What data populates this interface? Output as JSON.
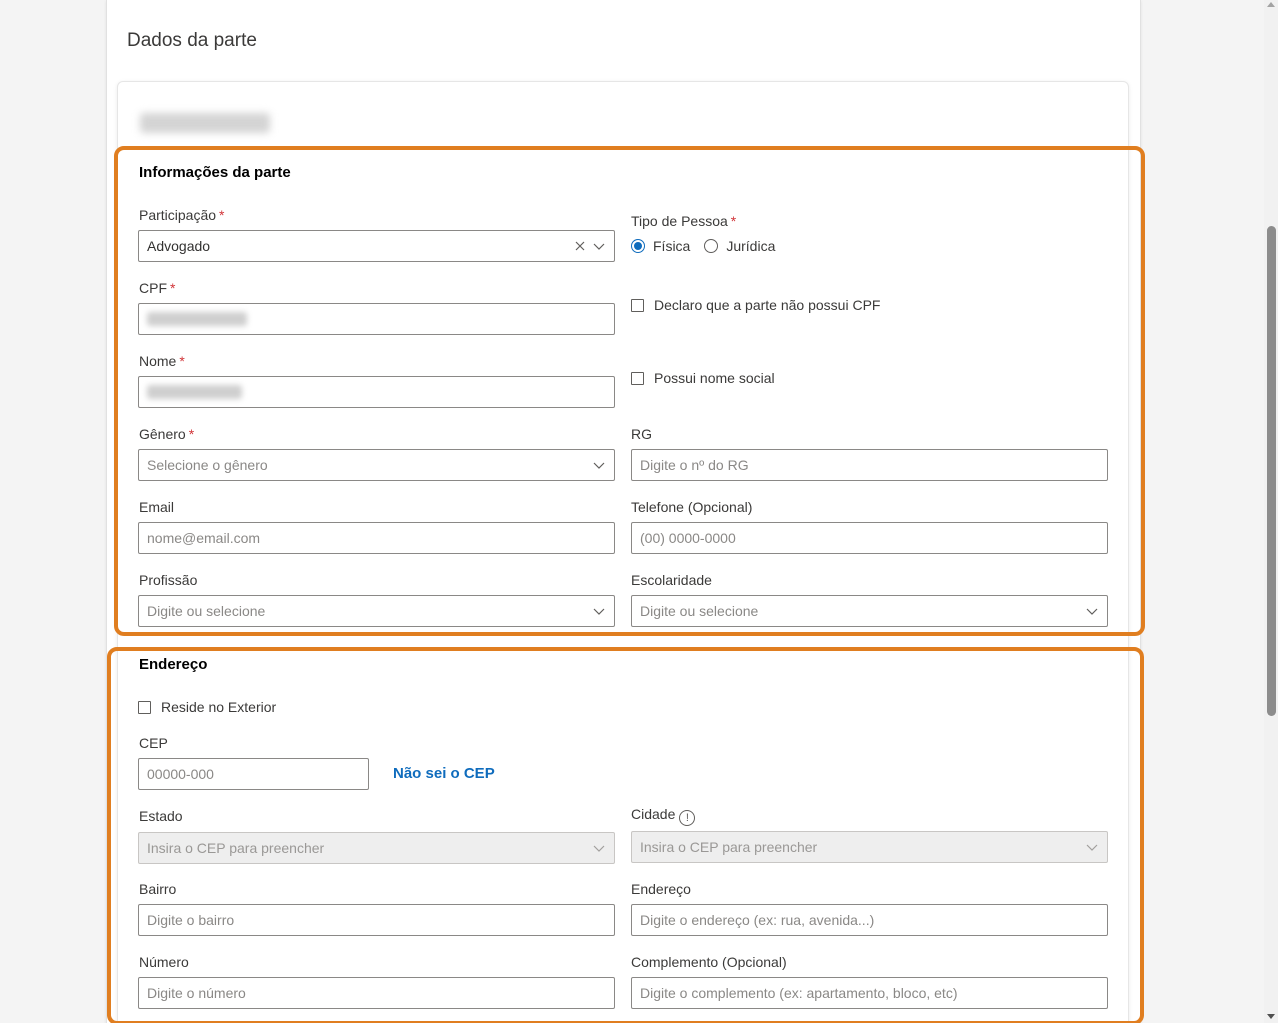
{
  "page": {
    "title": "Dados da parte"
  },
  "party_info": {
    "section_title": "Informações da parte",
    "participacao": {
      "label": "Participação",
      "required": "*",
      "value": "Advogado"
    },
    "tipo_pessoa": {
      "label": "Tipo de Pessoa",
      "required": "*",
      "options": [
        "Física",
        "Jurídica"
      ],
      "selected": "Física"
    },
    "cpf": {
      "label": "CPF",
      "required": "*"
    },
    "no_cpf": {
      "label": "Declaro que a parte não possui CPF"
    },
    "nome": {
      "label": "Nome",
      "required": "*"
    },
    "nome_social": {
      "label": "Possui nome social"
    },
    "genero": {
      "label": "Gênero",
      "required": "*",
      "placeholder": "Selecione o gênero"
    },
    "rg": {
      "label": "RG",
      "placeholder": "Digite o nº do RG"
    },
    "email": {
      "label": "Email",
      "placeholder": "nome@email.com"
    },
    "telefone": {
      "label": "Telefone (Opcional)",
      "placeholder": "(00) 0000-0000"
    },
    "profissao": {
      "label": "Profissão",
      "placeholder": "Digite ou selecione"
    },
    "escolaridade": {
      "label": "Escolaridade",
      "placeholder": "Digite ou selecione"
    }
  },
  "address": {
    "section_title": "Endereço",
    "exterior": {
      "label": "Reside no Exterior"
    },
    "cep": {
      "label": "CEP",
      "placeholder": "00000-000",
      "link": "Não sei o CEP"
    },
    "estado": {
      "label": "Estado",
      "placeholder": "Insira o CEP para preencher"
    },
    "cidade": {
      "label": "Cidade",
      "info_symbol": "!",
      "placeholder": "Insira o CEP para preencher"
    },
    "bairro": {
      "label": "Bairro",
      "placeholder": "Digite o bairro"
    },
    "endereco": {
      "label": "Endereço",
      "placeholder": "Digite o endereço (ex: rua, avenida...)"
    },
    "numero": {
      "label": "Número",
      "placeholder": "Digite o número"
    },
    "complemento": {
      "label": "Complemento (Opcional)",
      "placeholder": "Digite o complemento (ex: apartamento, bloco, etc)"
    }
  },
  "colors": {
    "highlight": "#e07e20",
    "accent": "#0f6cbd",
    "required": "#d13438"
  },
  "icons": [
    "chevron-down-icon",
    "clear-icon",
    "info-icon"
  ]
}
